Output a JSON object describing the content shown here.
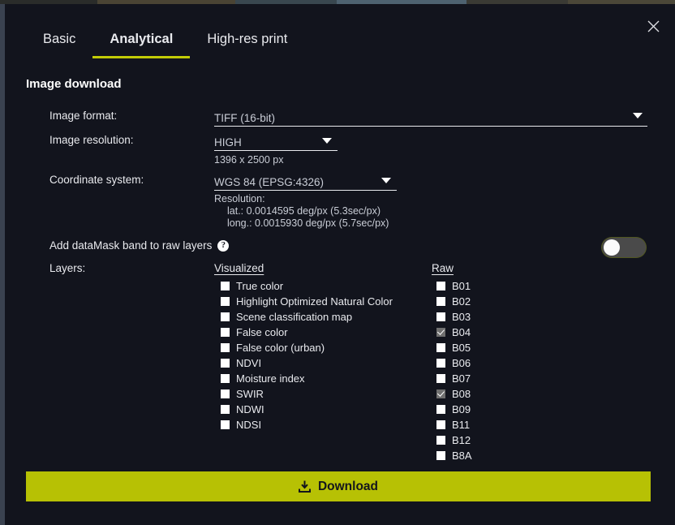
{
  "modal": {
    "close_label": "×",
    "section_title": "Image download"
  },
  "tabs": [
    {
      "label": "Basic",
      "active": false
    },
    {
      "label": "Analytical",
      "active": true
    },
    {
      "label": "High-res print",
      "active": false
    }
  ],
  "fields": {
    "image_format": {
      "label": "Image format:",
      "value": "TIFF (16-bit)"
    },
    "image_resolution": {
      "label": "Image resolution:",
      "value": "HIGH",
      "dimensions": "1396 x 2500 px"
    },
    "coordinate_system": {
      "label": "Coordinate system:",
      "value": "WGS 84 (EPSG:4326)",
      "resolution_title": "Resolution:",
      "resolution_lat": "lat.: 0.0014595 deg/px (5.3sec/px)",
      "resolution_long": "long.: 0.0015930 deg/px (5.7sec/px)"
    }
  },
  "datamask": {
    "label": "Add dataMask band to raw layers",
    "help_glyph": "?",
    "enabled": false
  },
  "layers": {
    "label": "Layers:",
    "visualized": {
      "header": "Visualized",
      "items": [
        {
          "label": "True color",
          "checked": false
        },
        {
          "label": "Highlight Optimized Natural Color",
          "checked": false
        },
        {
          "label": "Scene classification map",
          "checked": false
        },
        {
          "label": "False color",
          "checked": false
        },
        {
          "label": "False color (urban)",
          "checked": false
        },
        {
          "label": "NDVI",
          "checked": false
        },
        {
          "label": "Moisture index",
          "checked": false
        },
        {
          "label": "SWIR",
          "checked": false
        },
        {
          "label": "NDWI",
          "checked": false
        },
        {
          "label": "NDSI",
          "checked": false
        }
      ]
    },
    "raw": {
      "header": "Raw",
      "items": [
        {
          "label": "B01",
          "checked": false
        },
        {
          "label": "B02",
          "checked": false
        },
        {
          "label": "B03",
          "checked": false
        },
        {
          "label": "B04",
          "checked": true
        },
        {
          "label": "B05",
          "checked": false
        },
        {
          "label": "B06",
          "checked": false
        },
        {
          "label": "B07",
          "checked": false
        },
        {
          "label": "B08",
          "checked": true
        },
        {
          "label": "B09",
          "checked": false
        },
        {
          "label": "B11",
          "checked": false
        },
        {
          "label": "B12",
          "checked": false
        },
        {
          "label": "B8A",
          "checked": false
        }
      ]
    }
  },
  "download": {
    "label": "Download"
  },
  "colors": {
    "accent": "#b7c104",
    "panel_bg": "#12141d",
    "text": "#e9eaee",
    "checked_box": "#6f6f6f"
  }
}
